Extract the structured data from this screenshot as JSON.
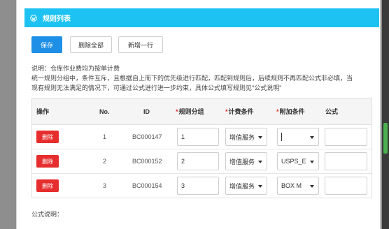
{
  "header": {
    "title": "规则列表",
    "icon": "wordpress-icon"
  },
  "toolbar": {
    "save_label": "保存",
    "delete_all_label": "删除全部",
    "add_row_label": "新增一行"
  },
  "description": {
    "line1": "说明：仓库作业费均为按单计费",
    "line2": "统一规则分组中，条件互斥，且根据自上而下的优先级进行匹配，匹配到规则后，后续规则不再匹配公式非必填，当",
    "line3": "现有规则无法满足的情况下，可通过公式进行进一步约束，具体公式填写规则见\"公式说明\""
  },
  "table": {
    "headers": {
      "op": "操作",
      "no": "No.",
      "id": "ID",
      "group": "规则分组",
      "cond": "计费条件",
      "extra": "附加条件",
      "formula": "公式"
    },
    "required_mark": "*",
    "rows": [
      {
        "delete_label": "删除",
        "no": "1",
        "id": "BC000147",
        "group": "1",
        "cond": "增值服务",
        "extra": "",
        "formula": ""
      },
      {
        "delete_label": "删除",
        "no": "2",
        "id": "BC000152",
        "group": "2",
        "cond": "增值服务",
        "extra": "USPS_E",
        "formula": ""
      },
      {
        "delete_label": "删除",
        "no": "3",
        "id": "BC000154",
        "group": "3",
        "cond": "增值服务",
        "extra": "BOX M",
        "formula": ""
      }
    ]
  },
  "formula_help": {
    "label": "公式说明："
  },
  "colors": {
    "header_bg": "#1ec2f2",
    "primary": "#1e8fe6",
    "danger": "#e72e2e",
    "required": "#e5312c"
  }
}
